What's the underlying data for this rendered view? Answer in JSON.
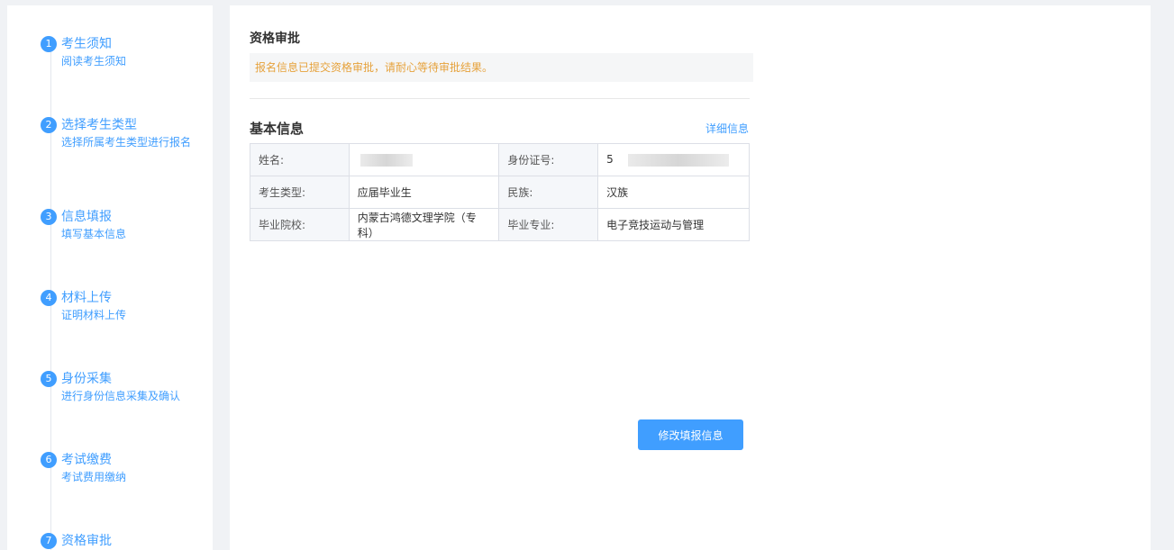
{
  "sidebar": {
    "steps": [
      {
        "num": "1",
        "title": "考生须知",
        "desc": "阅读考生须知"
      },
      {
        "num": "2",
        "title": "选择考生类型",
        "desc": "选择所属考生类型进行报名"
      },
      {
        "num": "3",
        "title": "信息填报",
        "desc": "填写基本信息"
      },
      {
        "num": "4",
        "title": "材料上传",
        "desc": "证明材料上传"
      },
      {
        "num": "5",
        "title": "身份采集",
        "desc": "进行身份信息采集及确认"
      },
      {
        "num": "6",
        "title": "考试缴费",
        "desc": "考试费用缴纳"
      },
      {
        "num": "7",
        "title": "资格审批",
        "desc": ""
      }
    ]
  },
  "main": {
    "section_title": "资格审批",
    "notice": "报名信息已提交资格审批，请耐心等待审批结果。",
    "basic_title": "基本信息",
    "detail_link": "详细信息",
    "table": {
      "row1": {
        "label1": "姓名:",
        "value1": "",
        "label2": "身份证号:",
        "value2": "5"
      },
      "row2": {
        "label1": "考生类型:",
        "value1": "应届毕业生",
        "label2": "民族:",
        "value2": "汉族"
      },
      "row3": {
        "label1": "毕业院校:",
        "value1": "内蒙古鸿德文理学院（专科）",
        "label2": "毕业专业:",
        "value2": "电子竞技运动与管理"
      }
    },
    "edit_button": "修改填报信息"
  },
  "colors": {
    "accent": "#409eff",
    "notice": "#e6a23c"
  }
}
